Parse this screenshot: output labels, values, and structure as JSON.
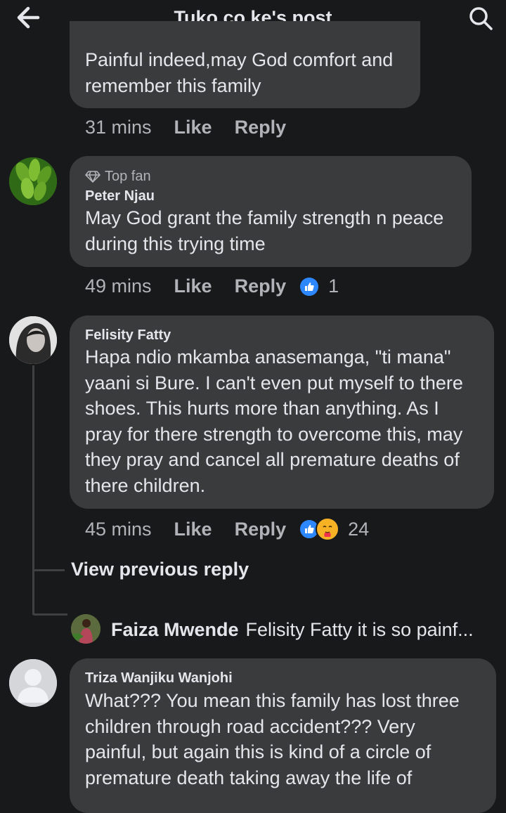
{
  "header": {
    "title": "Tuko.co.ke's post",
    "back_icon": "arrow-left-icon",
    "search_icon": "search-icon"
  },
  "comments": [
    {
      "text": "Painful indeed,may God comfort and\nremember this family",
      "time": "31 mins",
      "like_label": "Like",
      "reply_label": "Reply"
    },
    {
      "badge": "Top fan",
      "author": "Peter Njau",
      "text": "May God grant the family strength n peace\nduring this trying time",
      "time": "49 mins",
      "like_label": "Like",
      "reply_label": "Reply",
      "reaction_count": "1"
    },
    {
      "author": "Felisity Fatty",
      "text": "Hapa ndio mkamba anasemanga, \"ti mana\"\nyaani si Bure. I can't even put myself to there\nshoes. This hurts more than anything. As I\npray for there strength to overcome this, may\nthey pray and cancel all premature deaths of\nthere children.",
      "time": "45 mins",
      "like_label": "Like",
      "reply_label": "Reply",
      "reaction_count": "24",
      "view_previous": "View previous reply",
      "reply_preview": {
        "author": "Faiza Mwende",
        "text": "Felisity Fatty it is so painf..."
      }
    },
    {
      "author": "Triza Wanjiku Wanjohi",
      "text": "What??? You mean this family has lost three\nchildren through road accident??? Very\npainful, but again this is kind of a circle of\npremature death taking away the life of"
    }
  ],
  "colors": {
    "background": "#18191a",
    "bubble": "#3a3b3c",
    "like_blue": "#2d88ff",
    "care_yellow": "#f7b125"
  }
}
